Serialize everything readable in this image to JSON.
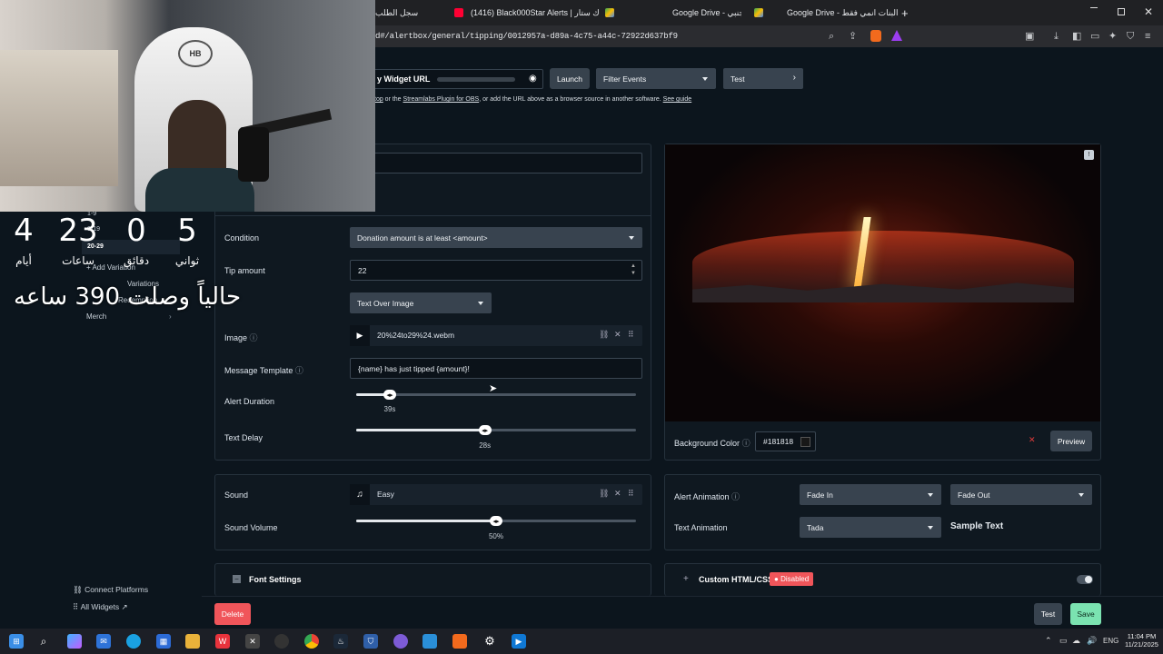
{
  "browser": {
    "tabs": [
      {
        "title": "سجل الطلب"
      },
      {
        "title": "(1416) Black000Star Alerts | بلاك ستار"
      },
      {
        "title": "Google Drive - اجنبي"
      },
      {
        "title": "Google Drive - البنات انمي فقط"
      }
    ],
    "new_tab": "+",
    "url": "d#/alertbox/general/tipping/0012957a-d89a-4c75-a44c-72922d637bf9"
  },
  "widget": {
    "url_label": "y Widget URL",
    "launch": "Launch",
    "filter_events": "Filter Events",
    "test": "Test",
    "help_prefix": "top",
    "help_or": " or the ",
    "help_plugin": "Streamlabs Plugin for OBS",
    "help_rest": ", or add the URL above as a browser source in another software. ",
    "help_guide": "See guide"
  },
  "sidebar": {
    "ranges": [
      "1-9",
      "0-19",
      "20-29"
    ],
    "items": [
      "Add Variation",
      "Variations",
      "Redemption",
      "Merch"
    ],
    "connect": "Connect Platforms",
    "all_widgets": "All Widgets"
  },
  "form": {
    "condition_label": "Condition",
    "condition_value": "Donation amount is at least <amount>",
    "tip_label": "Tip amount",
    "tip_value": "22",
    "layout_value": "Text Over Image",
    "image_label": "Image",
    "image_value": "20%24to29%24.webm",
    "template_label": "Message Template",
    "template_value": "{name} has just tipped {amount}!",
    "duration_label": "Alert Duration",
    "duration_value": "39s",
    "duration_fraction": 0.12,
    "delay_label": "Text Delay",
    "delay_value": "28s",
    "delay_fraction": 0.46
  },
  "preview": {
    "bg_label": "Background Color",
    "bg_value": "#181818",
    "preview_btn": "Preview"
  },
  "sound": {
    "sound_label": "Sound",
    "sound_value": "Easy",
    "volume_label": "Sound Volume",
    "volume_value": "50%",
    "volume_fraction": 0.5
  },
  "animation": {
    "alert_anim_label": "Alert Animation",
    "anim_in": "Fade In",
    "anim_out": "Fade Out",
    "text_anim_label": "Text Animation",
    "text_anim": "Tada",
    "sample_text": "Sample Text"
  },
  "sections": {
    "font_settings": "Font Settings",
    "custom_html": "Custom HTML/CSS",
    "disabled": "Disabled"
  },
  "footer": {
    "delete": "Delete",
    "test": "Test",
    "save": "Save"
  },
  "overlay": {
    "days": "4",
    "hours": "23",
    "minutes": "0",
    "seconds": "5",
    "days_label": "أيام",
    "hours_label": "ساعات",
    "minutes_label": "دقائق",
    "seconds_label": "ثواني",
    "banner": "حالياً وصلت 390 ساعه"
  },
  "taskbar": {
    "lang": "ENG",
    "time": "11:04 PM",
    "date": "11/21/2025"
  },
  "colors": {
    "accent_green": "#7be3b1",
    "danger": "#f0555a",
    "panel": "#0f1820"
  }
}
